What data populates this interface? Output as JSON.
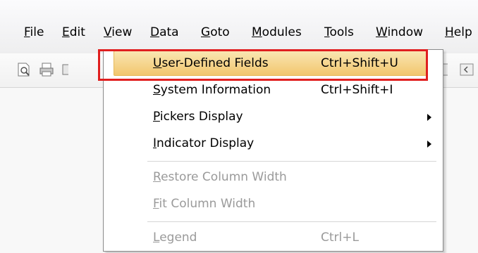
{
  "menubar": {
    "items": [
      {
        "prefix": "",
        "u": "F",
        "rest": "ile"
      },
      {
        "prefix": "",
        "u": "E",
        "rest": "dit"
      },
      {
        "prefix": "",
        "u": "V",
        "rest": "iew"
      },
      {
        "prefix": "",
        "u": "D",
        "rest": "ata"
      },
      {
        "prefix": "",
        "u": "G",
        "rest": "oto"
      },
      {
        "prefix": "",
        "u": "M",
        "rest": "odules"
      },
      {
        "prefix": "",
        "u": "T",
        "rest": "ools"
      },
      {
        "prefix": "",
        "u": "W",
        "rest": "indow"
      },
      {
        "prefix": "",
        "u": "H",
        "rest": "elp"
      }
    ]
  },
  "toolbar": {
    "icons": [
      "print-preview-icon",
      "print-icon",
      "toolbar-icon",
      "toolbar-icon",
      "toolbar-icon"
    ]
  },
  "dropdown": {
    "items": [
      {
        "u": "U",
        "rest": "ser-Defined Fields",
        "shortcut": "Ctrl+Shift+U",
        "state": "highlighted"
      },
      {
        "u": "S",
        "rest": "ystem Information",
        "shortcut": "Ctrl+Shift+I",
        "state": "enabled"
      },
      {
        "u": "P",
        "rest": "ickers Display",
        "shortcut": "",
        "state": "submenu"
      },
      {
        "u": "I",
        "rest": "ndicator Display",
        "shortcut": "",
        "state": "submenu"
      },
      {
        "u": "R",
        "rest": "estore Column Width",
        "shortcut": "",
        "state": "disabled"
      },
      {
        "u": "F",
        "rest": "it Column Width",
        "shortcut": "",
        "state": "disabled"
      },
      {
        "u": "L",
        "rest": "egend",
        "shortcut": "Ctrl+L",
        "state": "disabled"
      }
    ]
  },
  "colors": {
    "highlight": "#f2c66e",
    "annotation_box": "#e01f1f",
    "disabled_text": "#9a9a9a"
  }
}
